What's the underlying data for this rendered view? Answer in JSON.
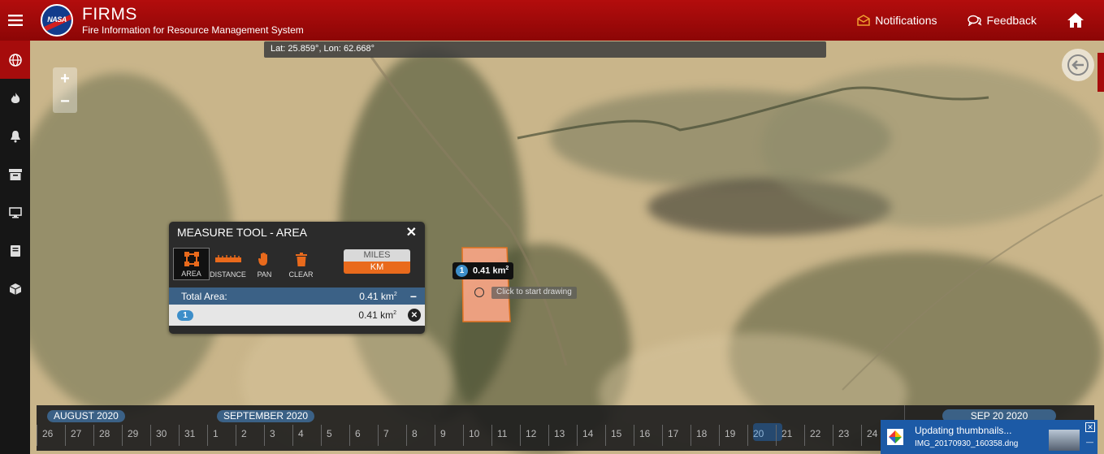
{
  "header": {
    "logo_text": "NASA",
    "app_name": "FIRMS",
    "app_subtitle": "Fire Information for Resource Management System",
    "notifications_label": "Notifications",
    "feedback_label": "Feedback"
  },
  "sidebar": {
    "items": [
      {
        "icon": "globe-icon",
        "active": true
      },
      {
        "icon": "fire-icon",
        "active": false
      },
      {
        "icon": "bell-icon",
        "active": false
      },
      {
        "icon": "archive-icon",
        "active": false
      },
      {
        "icon": "monitor-icon",
        "active": false
      },
      {
        "icon": "book-icon",
        "active": false
      },
      {
        "icon": "cube-icon",
        "active": false
      }
    ]
  },
  "map": {
    "coordinates": "Lat: 25.859°, Lon: 62.668°",
    "zoom_in": "+",
    "zoom_out": "−",
    "area_tooltip_num": "1",
    "area_tooltip_value": "0.41 km",
    "area_tooltip_sup": "2",
    "draw_hint": "Click to start drawing",
    "polygon_color": "#f4a484",
    "polygon_stroke": "#e8731f"
  },
  "measure_tool": {
    "title": "MEASURE TOOL - AREA",
    "close": "✕",
    "tools": [
      {
        "label": "AREA",
        "active": true
      },
      {
        "label": "DISTANCE",
        "active": false
      },
      {
        "label": "PAN",
        "active": false
      },
      {
        "label": "CLEAR",
        "active": false
      }
    ],
    "unit_miles": "MILES",
    "unit_km": "KM",
    "total_label": "Total Area:",
    "total_value": "0.41 km",
    "total_sup": "2",
    "collapse": "−",
    "entry_num": "1",
    "entry_value": "0.41 km",
    "entry_sup": "2",
    "remove": "✕"
  },
  "timeline": {
    "month1": "AUGUST 2020",
    "month2": "SEPTEMBER 2020",
    "selected_date": "SEP 20 2020",
    "days": [
      "26",
      "27",
      "28",
      "29",
      "30",
      "31",
      "1",
      "2",
      "3",
      "4",
      "5",
      "6",
      "7",
      "8",
      "9",
      "10",
      "11",
      "12",
      "13",
      "14",
      "15",
      "16",
      "17",
      "18",
      "19",
      "20",
      "21",
      "22",
      "23",
      "24"
    ],
    "selected_day": "20"
  },
  "toast": {
    "title": "Updating thumbnails...",
    "filename": "IMG_20170930_160358.dng",
    "close": "✕",
    "minimize": "—"
  },
  "colors": {
    "header_red": "#a60c0c",
    "accent_blue": "#3b6186",
    "km_orange": "#e96a1c"
  }
}
